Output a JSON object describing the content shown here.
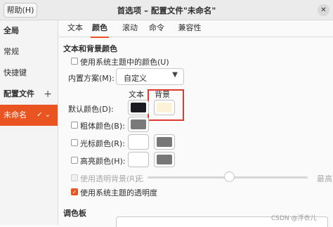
{
  "titlebar": {
    "help": "帮助(H)",
    "title": "首选项 – 配置文件\"未命名\"",
    "close": "✕"
  },
  "sidebar": {
    "global": "全局",
    "general": "常规",
    "shortcuts": "快捷键",
    "profiles": "配置文件",
    "add": "+",
    "profile_unnamed": "未命名",
    "profile_icons": "✓ ⌄"
  },
  "tabs": [
    "文本",
    "颜色",
    "滚动",
    "命令",
    "兼容性"
  ],
  "active_tab": "颜色",
  "colors": {
    "section_title": "文本和背景颜色",
    "use_system_colors": "使用系统主题中的颜色(U)",
    "builtin_scheme_label": "内置方案(M):",
    "builtin_scheme_value": "自定义",
    "col_text": "文本",
    "col_background": "背景",
    "default_color": "默认颜色(D):",
    "bold_color": "粗体颜色(B):",
    "cursor_color": "光标颜色(R):",
    "highlight_color": "高亮颜色(H):",
    "transparent_bg": "使用透明背景(R)",
    "slider_min": "无",
    "slider_max": "最高",
    "slider_level": 0.5,
    "system_transparency": "使用系统主题的透明度",
    "palette_title": "调色板",
    "swatches": {
      "default_text": "#1c1b22",
      "default_bg": "#fdf2d7",
      "bold": "#7a7a7a",
      "cursor_text": "#ffffff",
      "cursor_bg": "#777777",
      "highlight_text": "#ffffff",
      "highlight_bg": "#777777"
    }
  },
  "watermark": "CSDN @浮衣儿",
  "accent": "#e95420"
}
